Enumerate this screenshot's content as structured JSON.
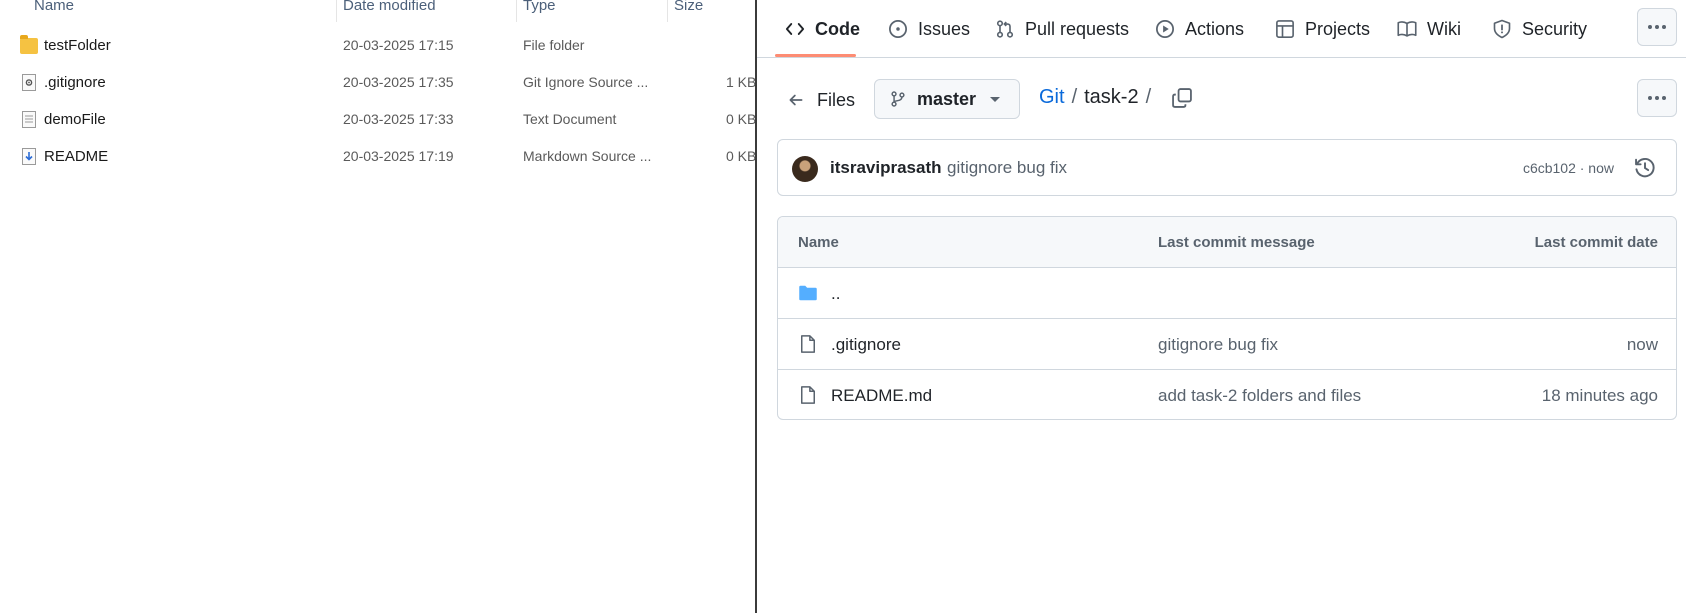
{
  "explorer": {
    "columns": {
      "name": "Name",
      "date_modified": "Date modified",
      "type": "Type",
      "size": "Size"
    },
    "rows": [
      {
        "icon": "folder-icon",
        "name": "testFolder",
        "date": "20-03-2025 17:15",
        "type": "File folder",
        "size": ""
      },
      {
        "icon": "gear-file-icon",
        "name": ".gitignore",
        "date": "20-03-2025 17:35",
        "type": "Git Ignore Source ...",
        "size": "1 KB"
      },
      {
        "icon": "text-file-icon",
        "name": "demoFile",
        "date": "20-03-2025 17:33",
        "type": "Text Document",
        "size": "0 KB"
      },
      {
        "icon": "markdown-file-icon",
        "name": "README",
        "date": "20-03-2025 17:19",
        "type": "Markdown Source ...",
        "size": "0 KB"
      }
    ]
  },
  "github": {
    "nav": {
      "tabs": [
        "Code",
        "Issues",
        "Pull requests",
        "Actions",
        "Projects",
        "Wiki",
        "Security"
      ],
      "active": "Code"
    },
    "files_label": "Files",
    "branch": "master",
    "breadcrumb": {
      "repo": "Git",
      "folder": "task-2",
      "separator": "/"
    },
    "latest_commit": {
      "author": "itsraviprasath",
      "message": "gitignore bug fix",
      "sha_time": "c6cb102 · now"
    },
    "table": {
      "headers": {
        "name": "Name",
        "message": "Last commit message",
        "date": "Last commit date"
      },
      "parent_dir": "..",
      "rows": [
        {
          "icon": "file-icon",
          "name": ".gitignore",
          "message": "gitignore bug fix",
          "date": "now"
        },
        {
          "icon": "file-icon",
          "name": "README.md",
          "message": "add task-2 folders and files",
          "date": "18 minutes ago"
        }
      ]
    },
    "colors": {
      "link": "#0969da",
      "border": "#d0d7de",
      "muted": "#59636e",
      "active_tab_underline": "#fd8c73",
      "folder_icon": "#54aeff"
    }
  }
}
